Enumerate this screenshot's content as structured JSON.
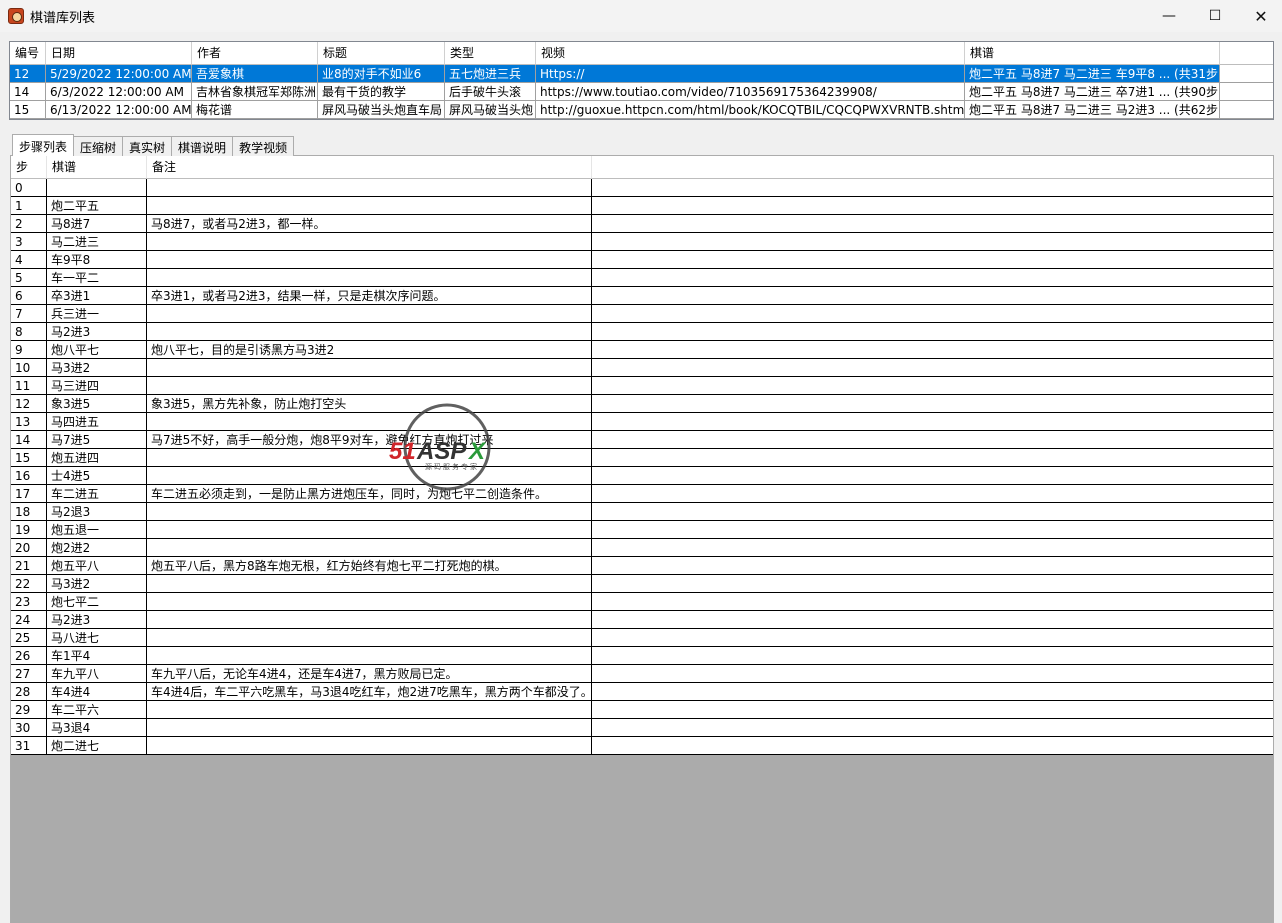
{
  "window": {
    "title": "棋谱库列表",
    "controls": {
      "minimize": "—",
      "maximize": "☐",
      "close": "✕"
    }
  },
  "library": {
    "columns": [
      "编号",
      "日期",
      "作者",
      "标题",
      "类型",
      "视频",
      "棋谱"
    ],
    "rows": [
      {
        "id": "12",
        "date": "5/29/2022 12:00:00 AM",
        "author": "吾爱象棋",
        "title": "业8的对手不如业6",
        "type": "五七炮进三兵",
        "video": "Https://",
        "moves": "炮二平五 马8进7 马二进三 车9平8  ... (共31步)",
        "selected": true
      },
      {
        "id": "14",
        "date": "6/3/2022 12:00:00 AM",
        "author": "吉林省象棋冠军郑陈洲",
        "title": "最有干货的教学",
        "type": "后手破牛头滚",
        "video": "https://www.toutiao.com/video/7103569175364239908/",
        "moves": "炮二平五 马8进7 马二进三 卒7进1  ... (共90步)",
        "selected": false
      },
      {
        "id": "15",
        "date": "6/13/2022 12:00:00 AM",
        "author": "梅花谱",
        "title": "屏风马破当头炮直车局",
        "type": "屏风马破当头炮",
        "video": "http://guoxue.httpcn.com/html/book/KOCQTBIL/CQCQPWXVRNTB.shtml",
        "moves": "炮二平五 马8进7 马二进三 马2进3  ... (共62步)",
        "selected": false
      }
    ]
  },
  "tabs": [
    "步骤列表",
    "压缩树",
    "真实树",
    "棋谱说明",
    "教学视频"
  ],
  "steps": {
    "columns": [
      "步",
      "棋谱",
      "备注"
    ],
    "rows": [
      {
        "step": "0",
        "move": "",
        "note": ""
      },
      {
        "step": "1",
        "move": "炮二平五",
        "note": ""
      },
      {
        "step": "2",
        "move": "马8进7",
        "note": "马8进7，或者马2进3，都一样。"
      },
      {
        "step": "3",
        "move": "马二进三",
        "note": ""
      },
      {
        "step": "4",
        "move": "车9平8",
        "note": ""
      },
      {
        "step": "5",
        "move": "车一平二",
        "note": ""
      },
      {
        "step": "6",
        "move": "卒3进1",
        "note": "卒3进1，或者马2进3，结果一样，只是走棋次序问题。"
      },
      {
        "step": "7",
        "move": "兵三进一",
        "note": ""
      },
      {
        "step": "8",
        "move": "马2进3",
        "note": ""
      },
      {
        "step": "9",
        "move": "炮八平七",
        "note": "炮八平七，目的是引诱黑方马3进2"
      },
      {
        "step": "10",
        "move": "马3进2",
        "note": ""
      },
      {
        "step": "11",
        "move": "马三进四",
        "note": ""
      },
      {
        "step": "12",
        "move": "象3进5",
        "note": "象3进5，黑方先补象，防止炮打空头"
      },
      {
        "step": "13",
        "move": "马四进五",
        "note": ""
      },
      {
        "step": "14",
        "move": "马7进5",
        "note": "马7进5不好，高手一般分炮，炮8平9对车，避免红方直炮打过来"
      },
      {
        "step": "15",
        "move": "炮五进四",
        "note": ""
      },
      {
        "step": "16",
        "move": "士4进5",
        "note": ""
      },
      {
        "step": "17",
        "move": "车二进五",
        "note": "车二进五必须走到，一是防止黑方进炮压车，同时，为炮七平二创造条件。"
      },
      {
        "step": "18",
        "move": "马2退3",
        "note": ""
      },
      {
        "step": "19",
        "move": "炮五退一",
        "note": ""
      },
      {
        "step": "20",
        "move": "炮2进2",
        "note": ""
      },
      {
        "step": "21",
        "move": "炮五平八",
        "note": "炮五平八后，黑方8路车炮无根，红方始终有炮七平二打死炮的棋。"
      },
      {
        "step": "22",
        "move": "马3进2",
        "note": ""
      },
      {
        "step": "23",
        "move": "炮七平二",
        "note": ""
      },
      {
        "step": "24",
        "move": "马2进3",
        "note": ""
      },
      {
        "step": "25",
        "move": "马八进七",
        "note": ""
      },
      {
        "step": "26",
        "move": "车1平4",
        "note": ""
      },
      {
        "step": "27",
        "move": "车九平八",
        "note": "车九平八后，无论车4进4，还是车4进7，黑方败局已定。"
      },
      {
        "step": "28",
        "move": "车4进4",
        "note": "车4进4后，车二平六吃黑车，马3退4吃红车，炮2进7吃黑车，黑方两个车都没了。"
      },
      {
        "step": "29",
        "move": "车二平六",
        "note": ""
      },
      {
        "step": "30",
        "move": "马3退4",
        "note": ""
      },
      {
        "step": "31",
        "move": "炮二进七",
        "note": ""
      }
    ]
  },
  "watermark": {
    "brand": "51ASPX",
    "slogan": "源码服务专家"
  }
}
